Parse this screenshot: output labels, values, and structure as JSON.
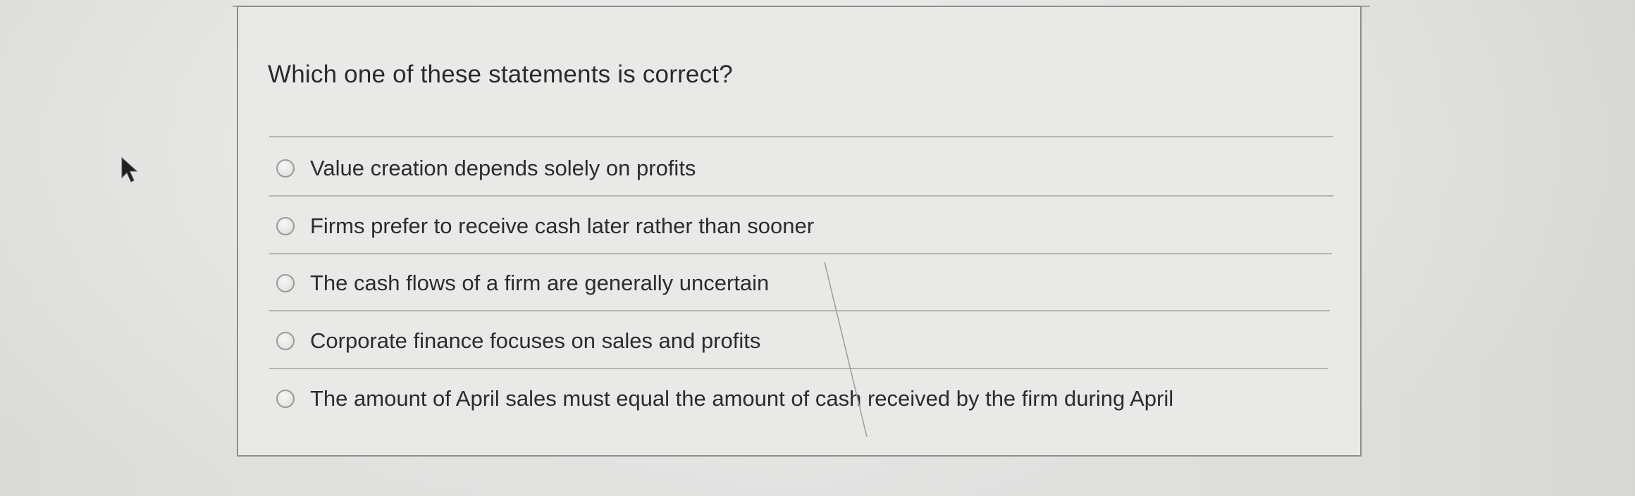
{
  "question": {
    "text": "Which one of these statements is correct?"
  },
  "options": [
    {
      "label": "Value creation depends solely on profits",
      "selected": false
    },
    {
      "label": "Firms prefer to receive cash later rather than sooner",
      "selected": false
    },
    {
      "label": "The cash flows of a firm are generally uncertain",
      "selected": false
    },
    {
      "label": "Corporate finance focuses on sales and profits",
      "selected": false
    },
    {
      "label": "The amount of April sales must equal the amount of cash received by the firm during April",
      "selected": false
    }
  ],
  "icons": {
    "pointer": "mouse-cursor-icon",
    "option_control": "radio-button-icon"
  },
  "colors": {
    "background": "#e9e9e7",
    "text": "#2c2c2c",
    "border": "#8e8e8c"
  }
}
